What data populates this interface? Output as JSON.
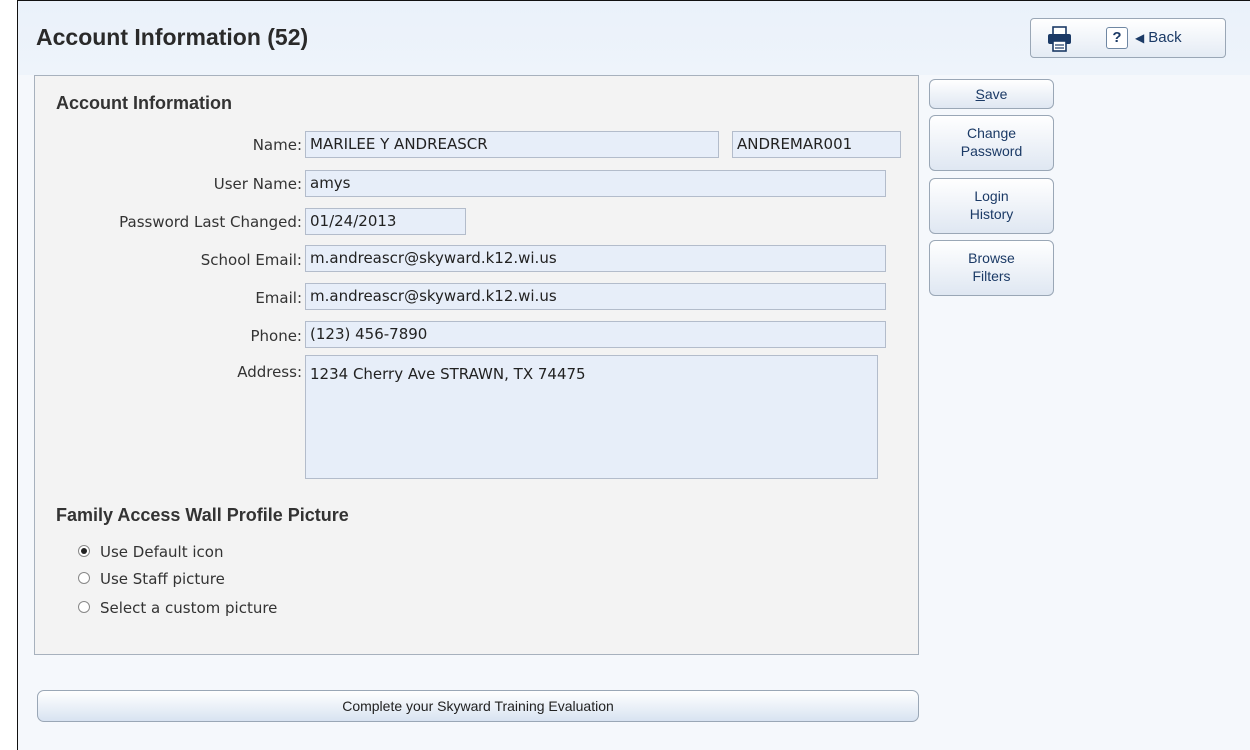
{
  "header": {
    "title": "Account Information (52)",
    "print_icon": "printer-icon",
    "help_label": "?",
    "back_icon": "triangle-left-icon",
    "back_label": "Back"
  },
  "account": {
    "section_title": "Account Information",
    "name_label": "Name:",
    "name_value": "MARILEE Y ANDREASCR",
    "name_id": "ANDREMAR001",
    "username_label": "User Name:",
    "username_value": "amys",
    "password_changed_label": "Password Last Changed:",
    "password_changed_value": "01/24/2013",
    "school_email_label": "School Email:",
    "school_email_value": "m.andreascr@skyward.k12.wi.us",
    "email_label": "Email:",
    "email_value": "m.andreascr@skyward.k12.wi.us",
    "phone_label": "Phone:",
    "phone_value": "(123) 456-7890",
    "address_label": "Address:",
    "address_value": "1234 Cherry Ave STRAWN, TX 74475"
  },
  "side_buttons": {
    "save_first": "S",
    "save_rest": "ave",
    "change_password_1": "Change",
    "change_password_2": "Password",
    "login_history_1": "Login",
    "login_history_2": "History",
    "browse_filters_1": "Browse",
    "browse_filters_2": "Filters"
  },
  "profile": {
    "title": "Family Access Wall Profile Picture",
    "options": [
      {
        "label": "Use Default icon",
        "selected": true
      },
      {
        "label": "Use Staff picture",
        "selected": false
      },
      {
        "label": "Select a custom picture",
        "selected": false
      }
    ]
  },
  "footer": {
    "evaluation_label": "Complete your Skyward Training Evaluation"
  },
  "colors": {
    "field_bg": "#e7eef9",
    "header_bg": "#eaf1fa",
    "link_text": "#1b3a66"
  }
}
